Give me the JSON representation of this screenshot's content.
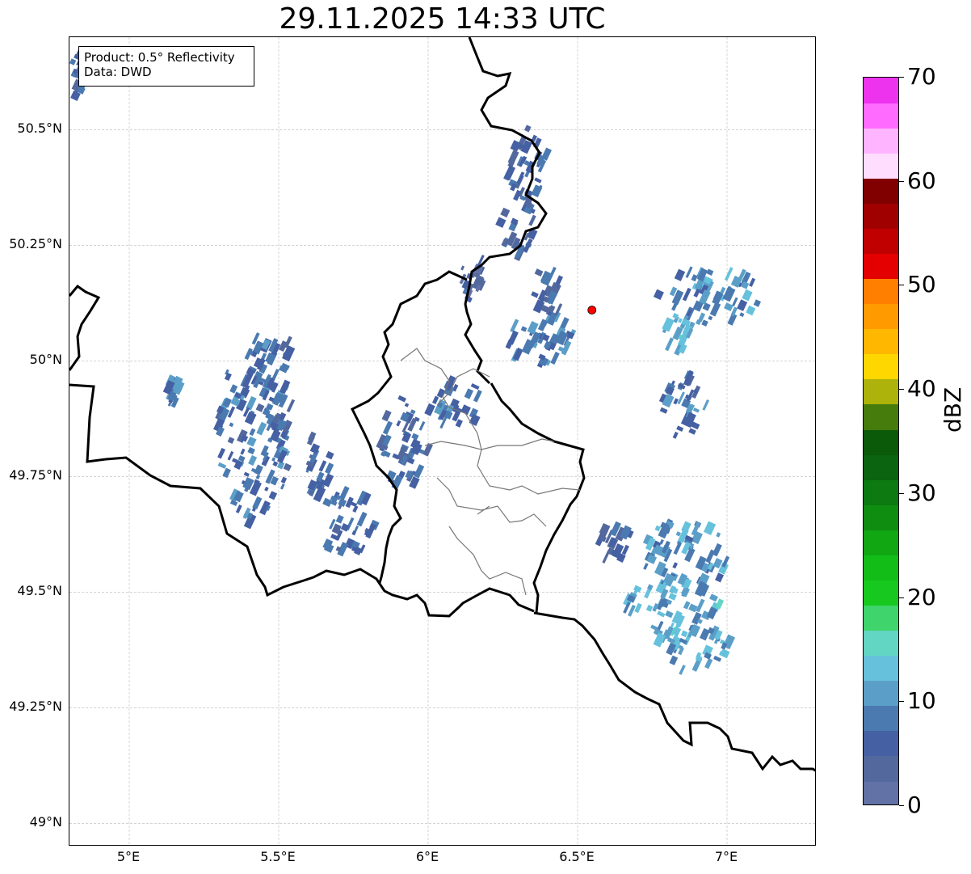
{
  "title": "29.11.2025 14:33 UTC",
  "info": {
    "product": "Product: 0.5° Reflectivity",
    "source": "Data: DWD"
  },
  "map": {
    "lon_range": [
      4.8,
      7.3
    ],
    "lat_range": [
      48.95,
      50.7
    ],
    "grid": true,
    "x_ticks": [
      {
        "lon": 5.0,
        "label": "5°E"
      },
      {
        "lon": 5.5,
        "label": "5.5°E"
      },
      {
        "lon": 6.0,
        "label": "6°E"
      },
      {
        "lon": 6.5,
        "label": "6.5°E"
      },
      {
        "lon": 7.0,
        "label": "7°E"
      }
    ],
    "y_ticks": [
      {
        "lat": 50.5,
        "label": "50.5°N"
      },
      {
        "lat": 50.25,
        "label": "50.25°N"
      },
      {
        "lat": 50.0,
        "label": "50°N"
      },
      {
        "lat": 49.75,
        "label": "49.75°N"
      },
      {
        "lat": 49.5,
        "label": "49.5°N"
      },
      {
        "lat": 49.25,
        "label": "49.25°N"
      },
      {
        "lat": 49.0,
        "label": "49°N"
      }
    ],
    "radar_site": {
      "lon": 6.548,
      "lat": 50.11,
      "color": "#ff0000"
    },
    "echo_areas": [
      {
        "lon": 6.33,
        "lat": 50.43,
        "rx": 0.07,
        "ry": 0.09,
        "dbz": 6
      },
      {
        "lon": 6.3,
        "lat": 50.3,
        "rx": 0.06,
        "ry": 0.08,
        "dbz": 5
      },
      {
        "lon": 6.15,
        "lat": 50.18,
        "rx": 0.05,
        "ry": 0.05,
        "dbz": 4
      },
      {
        "lon": 6.38,
        "lat": 50.05,
        "rx": 0.12,
        "ry": 0.06,
        "dbz": 8
      },
      {
        "lon": 6.4,
        "lat": 50.15,
        "rx": 0.06,
        "ry": 0.05,
        "dbz": 5
      },
      {
        "lon": 6.95,
        "lat": 50.14,
        "rx": 0.18,
        "ry": 0.06,
        "dbz": 9
      },
      {
        "lon": 6.84,
        "lat": 50.06,
        "rx": 0.05,
        "ry": 0.04,
        "dbz": 12
      },
      {
        "lon": 6.86,
        "lat": 49.9,
        "rx": 0.08,
        "ry": 0.07,
        "dbz": 7
      },
      {
        "lon": 6.1,
        "lat": 49.91,
        "rx": 0.1,
        "ry": 0.05,
        "dbz": 8
      },
      {
        "lon": 5.92,
        "lat": 49.82,
        "rx": 0.08,
        "ry": 0.1,
        "dbz": 6
      },
      {
        "lon": 5.42,
        "lat": 49.85,
        "rx": 0.12,
        "ry": 0.2,
        "dbz": 7
      },
      {
        "lon": 5.5,
        "lat": 49.95,
        "rx": 0.05,
        "ry": 0.12,
        "dbz": 6
      },
      {
        "lon": 5.73,
        "lat": 49.65,
        "rx": 0.1,
        "ry": 0.07,
        "dbz": 6
      },
      {
        "lon": 5.63,
        "lat": 49.78,
        "rx": 0.05,
        "ry": 0.08,
        "dbz": 5
      },
      {
        "lon": 6.86,
        "lat": 49.58,
        "rx": 0.15,
        "ry": 0.08,
        "dbz": 9
      },
      {
        "lon": 6.82,
        "lat": 49.47,
        "rx": 0.16,
        "ry": 0.06,
        "dbz": 11
      },
      {
        "lon": 6.88,
        "lat": 49.38,
        "rx": 0.14,
        "ry": 0.05,
        "dbz": 10
      },
      {
        "lon": 6.62,
        "lat": 49.61,
        "rx": 0.06,
        "ry": 0.04,
        "dbz": 5
      },
      {
        "lon": 5.15,
        "lat": 49.94,
        "rx": 0.02,
        "ry": 0.03,
        "dbz": 8
      },
      {
        "lon": 4.83,
        "lat": 50.62,
        "rx": 0.03,
        "ry": 0.05,
        "dbz": 6
      }
    ]
  },
  "colorbar": {
    "unit": "dBZ",
    "min": 0,
    "max": 70,
    "tick_labels": [
      "0",
      "10",
      "20",
      "30",
      "40",
      "50",
      "60",
      "70"
    ],
    "colors": [
      "#6272a6",
      "#53699e",
      "#4560a3",
      "#4a7ab0",
      "#5b9fc8",
      "#66c1dc",
      "#62d6c2",
      "#3fd46c",
      "#17c91e",
      "#13bd18",
      "#11a713",
      "#0f8d10",
      "#0c7a10",
      "#0a6410",
      "#0a5a0a",
      "#467c0c",
      "#adb30a",
      "#ffd700",
      "#ffb700",
      "#ff9b00",
      "#ff7f00",
      "#e40000",
      "#c00000",
      "#a00000",
      "#800000",
      "#ffddff",
      "#ffb4ff",
      "#ff6bff",
      "#ee33ee"
    ]
  }
}
